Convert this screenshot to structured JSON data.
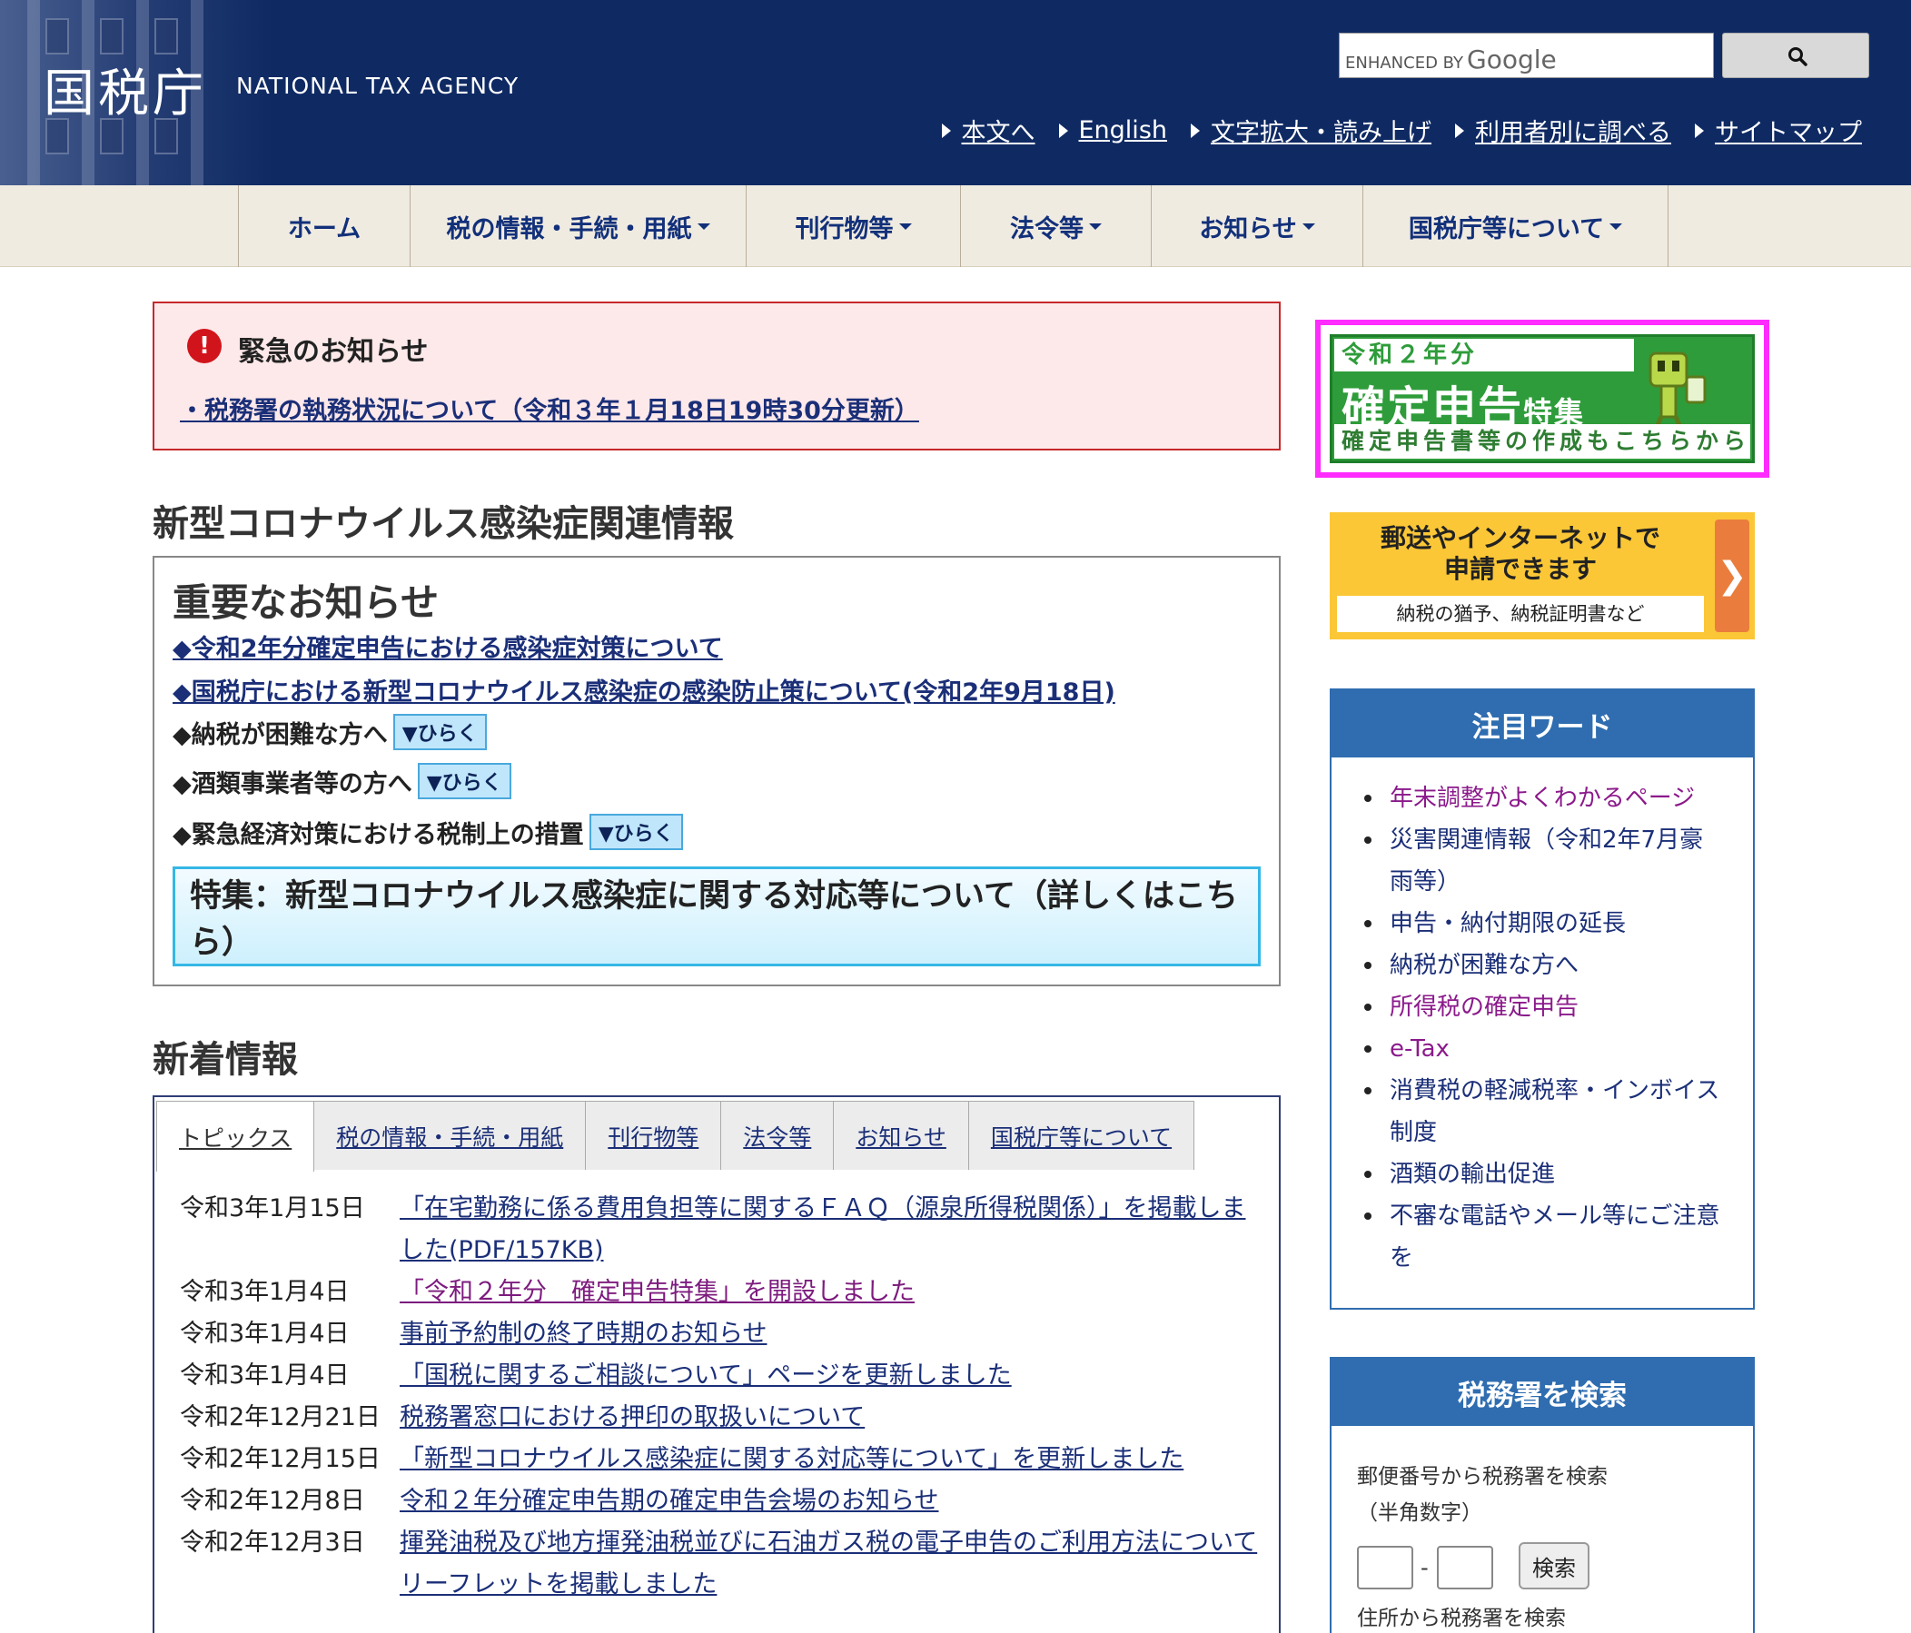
{
  "header": {
    "logo_jp": "国税庁",
    "logo_en": "NATIONAL TAX AGENCY",
    "search_enhanced": "ENHANCED BY",
    "search_brand": "Google",
    "util_links": [
      "本文へ",
      "English",
      "文字拡大・読み上げ",
      "利用者別に調べる",
      "サイトマップ"
    ]
  },
  "gnav": [
    "ホーム",
    "税の情報・手続・用紙",
    "刊行物等",
    "法令等",
    "お知らせ",
    "国税庁等について"
  ],
  "emergency": {
    "title": "緊急のお知らせ",
    "link": "・税務署の執務状況について（令和３年１月18日19時30分更新）"
  },
  "corona": {
    "section_title": "新型コロナウイルス感染症関連情報",
    "important_title": "重要なお知らせ",
    "links": [
      "◆令和2年分確定申告における感染症対策について",
      "◆国税庁における新型コロナウイルス感染症の感染防止策について(令和2年9月18日)"
    ],
    "expandables": [
      {
        "label": "◆納税が困難な方へ",
        "button": "▼ひらく"
      },
      {
        "label": "◆酒類事業者等の方へ",
        "button": "▼ひらく"
      },
      {
        "label": "◆緊急経済対策における税制上の措置",
        "button": "▼ひらく"
      }
    ],
    "feature": "特集：新型コロナウイルス感染症に関する対応等について（詳しくはこちら）"
  },
  "news": {
    "title": "新着情報",
    "tabs": [
      "トピックス",
      "税の情報・手続・用紙",
      "刊行物等",
      "法令等",
      "お知らせ",
      "国税庁等について"
    ],
    "items": [
      {
        "date": "令和3年1月15日",
        "text": "「在宅勤務に係る費用負担等に関するＦＡＱ（源泉所得税関係）」を掲載しました(PDF/157KB)"
      },
      {
        "date": "令和3年1月4日",
        "text": "「令和２年分　確定申告特集」を開設しました"
      },
      {
        "date": "令和3年1月4日",
        "text": "事前予約制の終了時期のお知らせ"
      },
      {
        "date": "令和3年1月4日",
        "text": "「国税に関するご相談について」ページを更新しました"
      },
      {
        "date": "令和2年12月21日",
        "text": "税務署窓口における押印の取扱いについて"
      },
      {
        "date": "令和2年12月15日",
        "text": "「新型コロナウイルス感染症に関する対応等について」を更新しました"
      },
      {
        "date": "令和2年12月8日",
        "text": "令和２年分確定申告期の確定申告会場のお知らせ"
      },
      {
        "date": "令和2年12月3日",
        "text": "揮発油税及び地方揮発油税並びに石油ガス税の電子申告のご利用方法についてリーフレットを掲載しました"
      }
    ]
  },
  "sidebar": {
    "banner_year": "令和２年分",
    "banner_main": "確定申告",
    "banner_main_suffix": "特集",
    "banner_sub": "確定申告書等の作成もこちらから",
    "mail_banner_line1": "郵送やインターネットで",
    "mail_banner_line2": "申請できます",
    "mail_banner_sub": "納税の猶予、納税証明書など",
    "attention_title": "注目ワード",
    "attention_items": [
      "年末調整がよくわかるページ",
      "災害関連情報（令和2年7月豪雨等）",
      "申告・納付期限の延長",
      "納税が困難な方へ",
      "所得税の確定申告",
      "e-Tax",
      "消費税の軽減税率・インボイス制度",
      "酒類の輸出促進",
      "不審な電話やメール等にご注意を"
    ],
    "office_title": "税務署を検索",
    "office_zip_label": "郵便番号から税務署を検索",
    "office_zip_note": "（半角数字）",
    "office_search_button": "検索",
    "office_zip_dash": "-",
    "office_address_label": "住所から税務署を検索"
  }
}
